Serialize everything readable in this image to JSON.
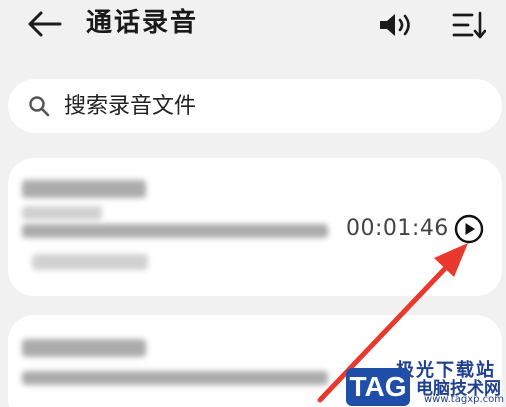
{
  "header": {
    "title": "通话录音",
    "back_icon": "back-arrow-icon",
    "speaker_icon": "speaker-icon",
    "sort_icon": "sort-icon"
  },
  "search": {
    "placeholder": "搜索录音文件",
    "icon": "search-icon"
  },
  "recordings": [
    {
      "duration": "00:01:46",
      "play_icon": "play-icon"
    },
    {
      "duration": "",
      "play_icon": ""
    }
  ],
  "watermark": {
    "tag": "TAG",
    "site_name": "电脑技术网",
    "top_text": "极光下载站",
    "url": "www.tagxp.com"
  },
  "colors": {
    "background": "#f1f1f1",
    "card": "#ffffff",
    "annotation_arrow": "#e8392c",
    "watermark_blue": "#1e4ea8"
  }
}
